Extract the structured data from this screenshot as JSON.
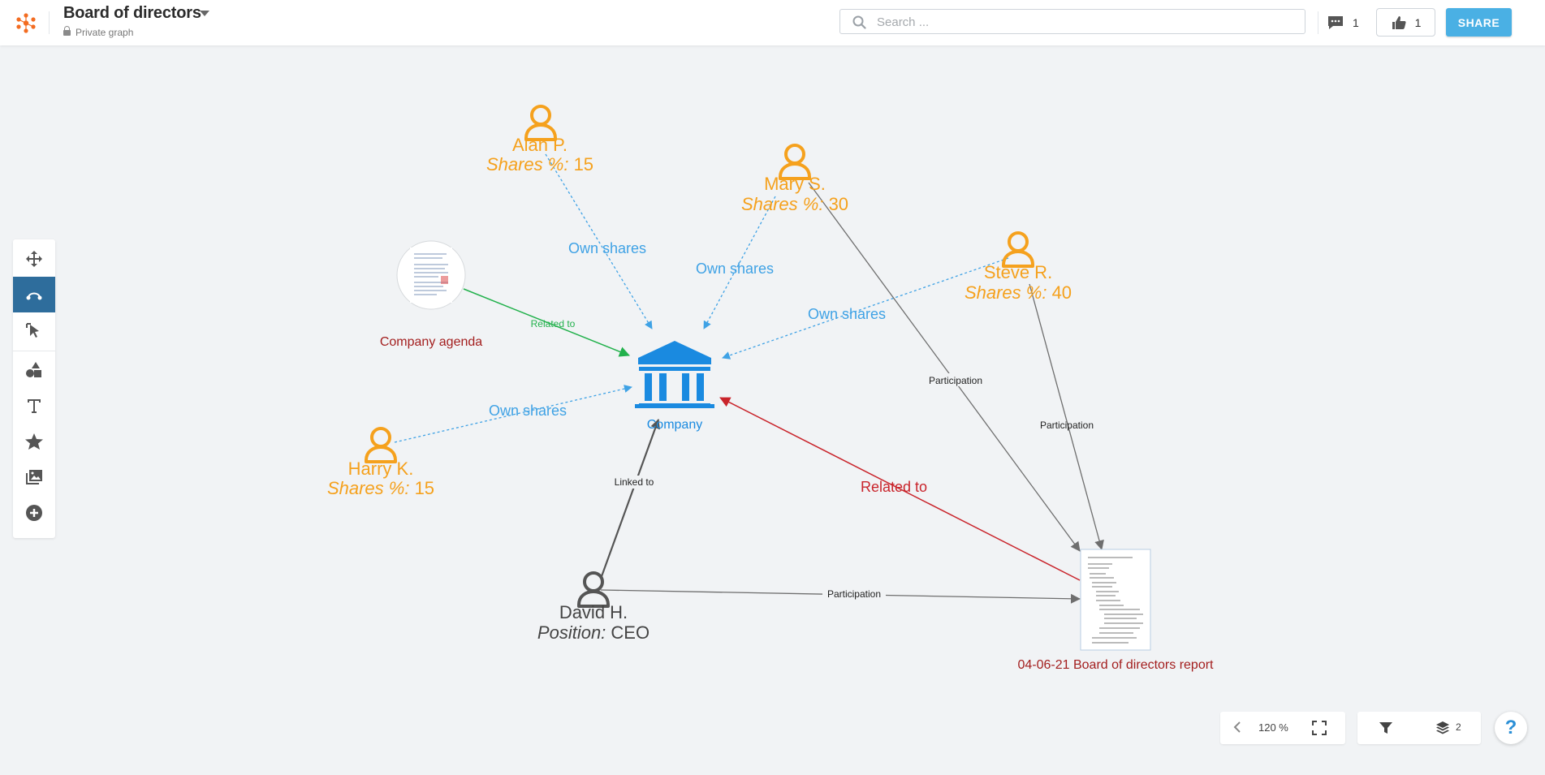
{
  "header": {
    "title": "Board of directors",
    "subtitle": "Private graph",
    "search_placeholder": "Search ...",
    "comments_count": "1",
    "likes_count": "1",
    "share_label": "SHARE"
  },
  "graph": {
    "nodes": {
      "alan": {
        "name": "Alan P.",
        "attr_label": "Shares %:",
        "attr_value": " 15"
      },
      "mary": {
        "name": "Mary S.",
        "attr_label": "Shares %:",
        "attr_value": " 30"
      },
      "steve": {
        "name": "Steve R.",
        "attr_label": "Shares %:",
        "attr_value": " 40"
      },
      "harry": {
        "name": "Harry K.",
        "attr_label": "Shares %:",
        "attr_value": " 15"
      },
      "david": {
        "name": "David H.",
        "attr_label": "Position:",
        "attr_value": " CEO"
      },
      "company": {
        "name": "Company"
      },
      "agenda": {
        "name": "Company agenda"
      },
      "report": {
        "name": "04-06-21 Board of directors report"
      }
    },
    "edges": {
      "own_shares": "Own shares",
      "related_to": "Related to",
      "participation": "Participation",
      "linked_to": "Linked to"
    }
  },
  "footer": {
    "zoom_level": "120 %",
    "layers_count": "2",
    "help_label": "?"
  },
  "colors": {
    "person": "#f5a11d",
    "company": "#1a8ae0",
    "edge_blue": "#3fa2e5",
    "related_green": "#22b14c",
    "related_red": "#c9242b",
    "gray_edge": "#6e6e6e",
    "accent": "#4ab0e4"
  }
}
